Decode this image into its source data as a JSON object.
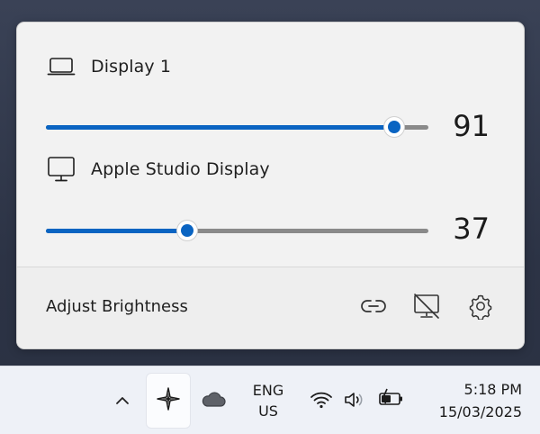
{
  "flyout": {
    "displays": [
      {
        "name": "Display 1",
        "icon": "laptop-icon",
        "brightness": 91,
        "brightness_label": "91"
      },
      {
        "name": "Apple Studio Display",
        "icon": "monitor-icon",
        "brightness": 37,
        "brightness_label": "37"
      }
    ],
    "footer": {
      "title": "Adjust Brightness",
      "buttons": [
        "link-icon",
        "display-off-icon",
        "settings-gear-icon"
      ]
    },
    "colors": {
      "accent": "#0a64c2",
      "track": "#8a8a8a",
      "panel": "#f2f2f2"
    }
  },
  "taskbar": {
    "icons": [
      "chevron-up-icon",
      "twinkle-tray-app-icon",
      "weather-cloud-icon",
      "wifi-icon",
      "volume-icon",
      "battery-charging-icon"
    ],
    "language": {
      "line1": "ENG",
      "line2": "US"
    },
    "clock": {
      "time": "5:18 PM",
      "date": "15/03/2025"
    }
  }
}
